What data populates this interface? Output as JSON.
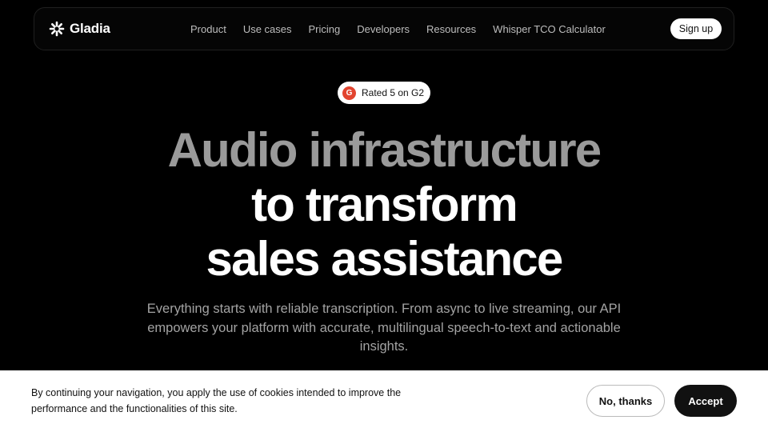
{
  "brand": {
    "name": "Gladia",
    "logo_icon": "gladia-asterisk-icon"
  },
  "nav": {
    "links": [
      "Product",
      "Use cases",
      "Pricing",
      "Developers",
      "Resources",
      "Whisper TCO Calculator"
    ],
    "signup_label": "Sign up"
  },
  "badge": {
    "icon": "g2-icon",
    "icon_letter": "G",
    "text": "Rated 5 on G2"
  },
  "hero": {
    "line1": "Audio infrastructure",
    "line2": "to transform",
    "line3": "sales assistance",
    "subtitle": "Everything starts with reliable transcription. From async to live streaming, our API empowers your platform with accurate, multilingual speech-to-text and actionable insights."
  },
  "cookie": {
    "text": "By continuing your navigation, you apply the use of cookies intended to improve the performance and the functionalities of this site.",
    "decline_label": "No, thanks",
    "accept_label": "Accept"
  },
  "colors": {
    "background": "#000000",
    "hero_muted": "#9a9a9a",
    "g2_red": "#e2442f",
    "cookie_bg": "#ffffff",
    "accept_bg": "#111111"
  }
}
